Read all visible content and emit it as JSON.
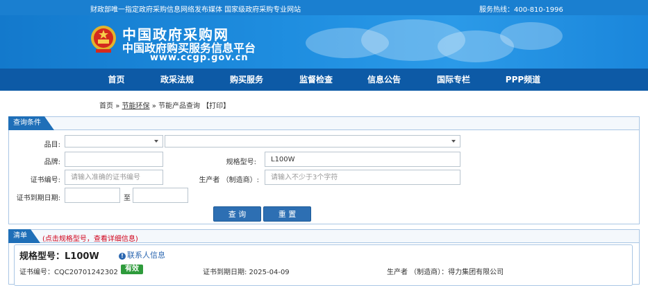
{
  "topbar": {
    "left_text": "财政部唯一指定政府采购信息网络发布媒体 国家级政府采购专业网站",
    "right_text": "服务热线：400-810-1996"
  },
  "banner": {
    "title": "中国政府采购网",
    "subtitle": "中国政府购买服务信息平台",
    "url": "www.ccgp.gov.cn"
  },
  "nav": {
    "items": [
      "首页",
      "政采法规",
      "购买服务",
      "监督检查",
      "信息公告",
      "国际专栏",
      "PPP频道"
    ]
  },
  "breadcrumb": {
    "home": "首页",
    "sep1": "»",
    "section": "节能环保",
    "sep2": "»",
    "page": "节能产品查询",
    "print": "【打印】"
  },
  "query": {
    "tab_label": "查询条件",
    "category_label": "品目:",
    "brand_label": "品牌:",
    "model_label": "规格型号:",
    "model_value": "L100W",
    "cert_label": "证书编号:",
    "cert_placeholder": "请输入准确的证书编号",
    "maker_label": "生产者 （制造商）:",
    "maker_placeholder": "请输入不少于3个字符",
    "expiry_label": "证书到期日期:",
    "to_label": "至",
    "search_button": "查 询",
    "reset_button": "重 置"
  },
  "list": {
    "tab_label": "清单",
    "hint": "(点击规格型号，查看详细信息)",
    "item": {
      "title": "规格型号：L100W",
      "contact": "联系人信息",
      "cert_text": "证书编号：CQC20701242302",
      "status": "有效",
      "expiry_text": "证书到期日期: 2025-04-09",
      "maker_text": "生产者 （制造商）：得力集团有限公司"
    }
  },
  "colors": {
    "header_blue": "#1a7fd0",
    "nav_blue": "#0d5aa6",
    "tab_blue": "#1f6fb8",
    "button_blue": "#2d6fb3",
    "valid_green": "#2e9b3b",
    "hint_red": "#d0021b"
  }
}
